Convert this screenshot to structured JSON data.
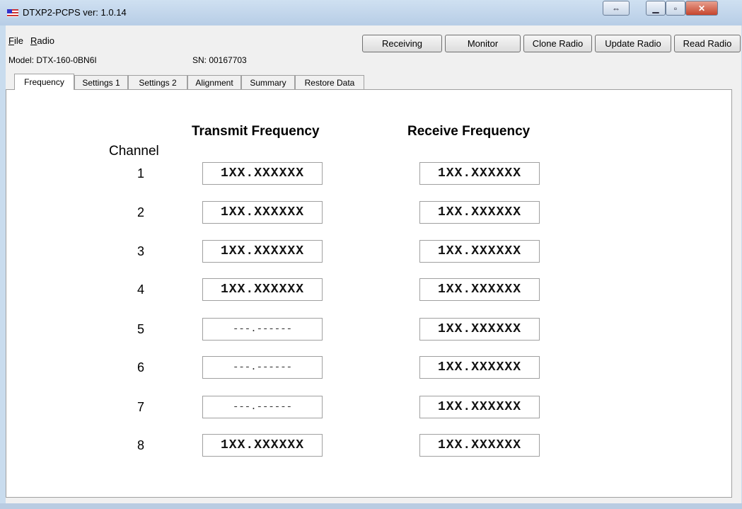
{
  "window": {
    "title": "DTXP2-PCPS ver: 1.0.14"
  },
  "menu": [
    "File",
    "Radio"
  ],
  "actions": [
    "Receiving",
    "Monitor",
    "Clone Radio",
    "Update Radio",
    "Read Radio"
  ],
  "info": {
    "model": "Model: DTX-160-0BN6I",
    "sn": "SN: 00167703"
  },
  "tabs": [
    "Frequency",
    "Settings 1",
    "Settings 2",
    "Alignment",
    "Summary",
    "Restore Data"
  ],
  "active_tab": "Frequency",
  "grid": {
    "channel_label": "Channel",
    "transmit_label": "Transmit Frequency",
    "receive_label": "Receive Frequency",
    "rows": [
      {
        "ch": "1",
        "tx": "1XX.XXXXXX",
        "rx": "1XX.XXXXXX"
      },
      {
        "ch": "2",
        "tx": "1XX.XXXXXX",
        "rx": "1XX.XXXXXX"
      },
      {
        "ch": "3",
        "tx": "1XX.XXXXXX",
        "rx": "1XX.XXXXXX"
      },
      {
        "ch": "4",
        "tx": "1XX.XXXXXX",
        "rx": "1XX.XXXXXX"
      },
      {
        "ch": "5",
        "tx": "---.------",
        "rx": "1XX.XXXXXX"
      },
      {
        "ch": "6",
        "tx": "---.------",
        "rx": "1XX.XXXXXX"
      },
      {
        "ch": "7",
        "tx": "---.------",
        "rx": "1XX.XXXXXX"
      },
      {
        "ch": "8",
        "tx": "1XX.XXXXXX",
        "rx": "1XX.XXXXXX"
      }
    ]
  },
  "icons": {
    "app": "us-flag-icon",
    "resize": "resize-arrows-icon",
    "minimize": "minimize-icon",
    "maximize": "maximize-icon",
    "close": "close-icon"
  },
  "colors": {
    "titlebar": "#b7cde6",
    "close": "#c6452d",
    "panel": "#ffffff"
  }
}
